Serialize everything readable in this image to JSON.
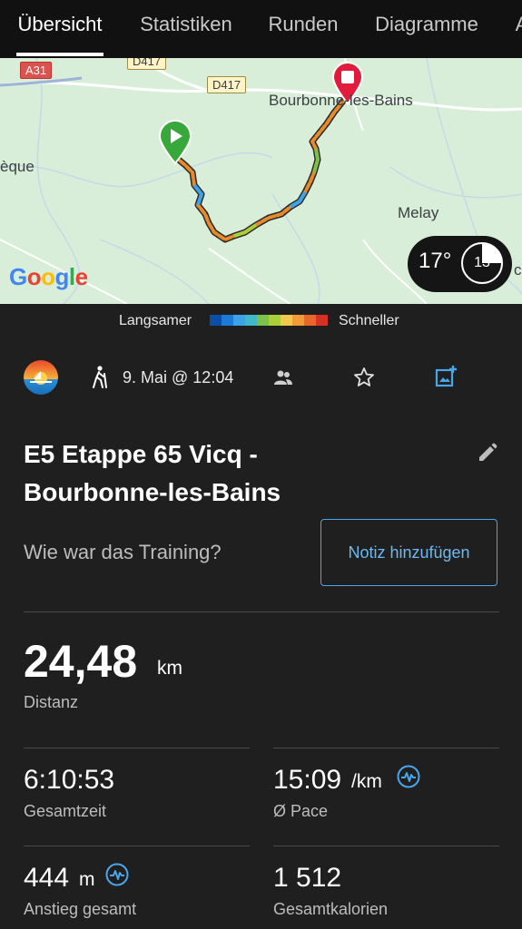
{
  "tabs": [
    {
      "label": "Übersicht",
      "active": true
    },
    {
      "label": "Statistiken"
    },
    {
      "label": "Runden"
    },
    {
      "label": "Diagramme"
    },
    {
      "label": "A"
    }
  ],
  "map": {
    "labels": {
      "city_main": "Bourbonne-les-Bains",
      "city_melay": "Melay",
      "edge_left": "èque",
      "edge_right": "c"
    },
    "roads": {
      "a31": "A31",
      "d417_top": "D417",
      "d417": "D417"
    },
    "google_logo": "Google",
    "weather": {
      "temperature": "17°",
      "gauge_value": "13"
    }
  },
  "legend": {
    "slower": "Langsamer",
    "faster": "Schneller",
    "colors": [
      "#0b4ea8",
      "#1e7ad8",
      "#3ea2e8",
      "#40b9c9",
      "#7cc24a",
      "#a9cf3a",
      "#f2c94c",
      "#f29b38",
      "#e8662c",
      "#d83024"
    ]
  },
  "activity": {
    "date": "9. Mai @ 12:04",
    "title_line1": "E5 Etappe 65 Vicq -",
    "title_line2": "Bourbonne-les-Bains",
    "question": "Wie war das Training?",
    "note_button": "Notiz hinzufügen"
  },
  "stats": {
    "distance": {
      "value": "24,48",
      "unit": "km",
      "label": "Distanz"
    },
    "total_time": {
      "value": "6:10:53",
      "label": "Gesamtzeit"
    },
    "pace": {
      "value": "15:09",
      "unit": "/km",
      "label": "Ø Pace"
    },
    "ascent": {
      "value": "444",
      "unit": "m",
      "label": "Anstieg gesamt"
    },
    "calories": {
      "value": "1 512",
      "label": "Gesamtkalorien"
    }
  }
}
